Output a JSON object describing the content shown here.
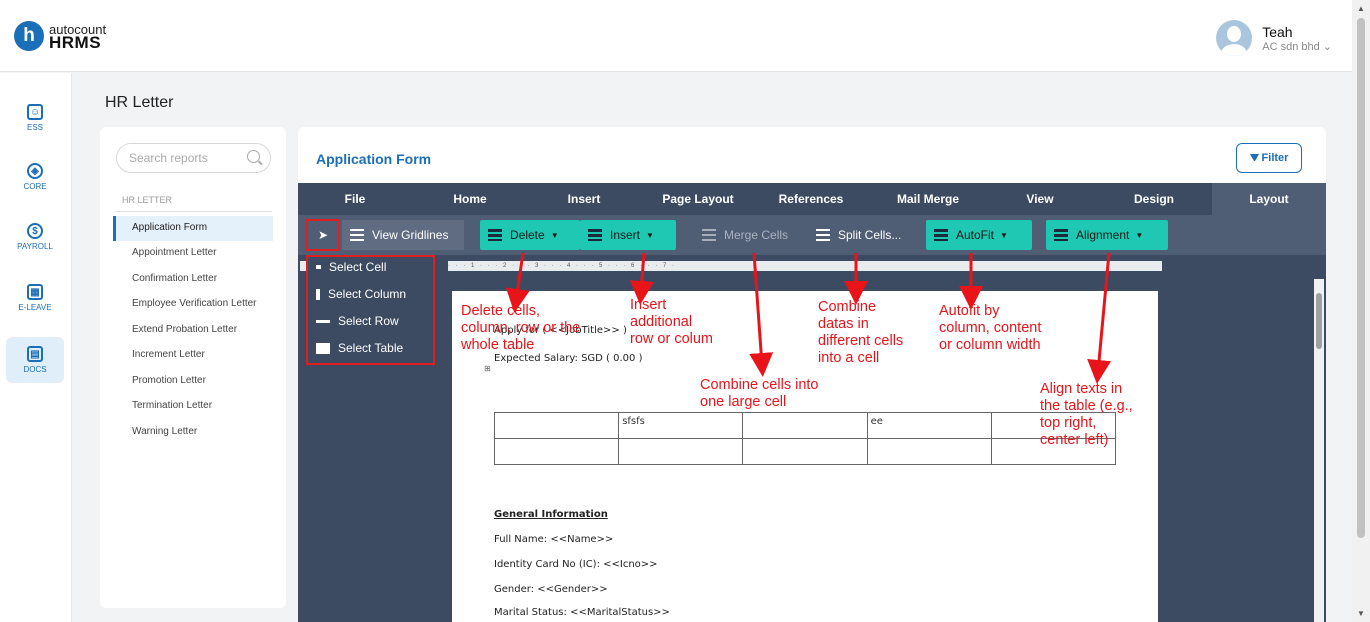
{
  "brand": {
    "logo_letter": "h",
    "top": "autocount",
    "bottom": "HRMS"
  },
  "user": {
    "name": "Teah",
    "company": "AC sdn bhd"
  },
  "nav": [
    {
      "label": "ESS",
      "icon": "id-card-icon"
    },
    {
      "label": "CORE",
      "icon": "cube-icon"
    },
    {
      "label": "PAYROLL",
      "icon": "dollar-icon"
    },
    {
      "label": "E-LEAVE",
      "icon": "calendar-icon"
    },
    {
      "label": "DOCS",
      "icon": "document-chart-icon"
    }
  ],
  "page_title": "HR Letter",
  "search_placeholder": "Search reports",
  "report_section": "HR LETTER",
  "reports": [
    "Application Form",
    "Appointment Letter",
    "Confirmation Letter",
    "Employee Verification Letter",
    "Extend Probation Letter",
    "Increment Letter",
    "Promotion Letter",
    "Termination Letter",
    "Warning Letter"
  ],
  "main_title": "Application Form",
  "filter_label": "Filter",
  "ribbon_tabs": [
    "File",
    "Home",
    "Insert",
    "Page Layout",
    "References",
    "Mail Merge",
    "View",
    "Design",
    "Layout"
  ],
  "tools": {
    "view_gridlines": "View Gridlines",
    "delete": "Delete",
    "insert": "Insert",
    "merge": "Merge Cells",
    "split": "Split Cells...",
    "autofit": "AutoFit",
    "alignment": "Alignment"
  },
  "select_menu": [
    "Select Cell",
    "Select Column",
    "Select Row",
    "Select Table"
  ],
  "ruler_text": "· · · 1 · · · 2 · · · 3 · · · 4 · · · 5 · · · 6 · · · 7 ·",
  "document": {
    "apply_for": "Apply for ( <<JobTitle>> )",
    "salary": "Expected Salary: SGD ( 0.00 )",
    "table": [
      [
        "",
        "sfsfs",
        "",
        "ee",
        ""
      ],
      [
        "",
        "",
        "",
        "",
        ""
      ]
    ],
    "section_heading": "General Information",
    "lines": [
      "Full Name: <<Name>>",
      "Identity Card No (IC): <<Icno>>",
      "Gender: <<Gender>>",
      "Marital Status: <<MaritalStatus>>"
    ]
  },
  "annotations": {
    "delete": [
      "Delete cells,",
      "column, row or the",
      "whole table"
    ],
    "insert": [
      "Insert",
      "additional",
      "row or colum"
    ],
    "merge": [
      "Combine cells into",
      "one large cell"
    ],
    "split": [
      "Combine",
      "datas in",
      "different cells",
      "into a cell"
    ],
    "autofit": [
      "Autofit by",
      "column, content",
      "or column width"
    ],
    "alignment": [
      "Align texts in",
      "the table (e.g.,",
      "top right,",
      "center left)"
    ]
  }
}
